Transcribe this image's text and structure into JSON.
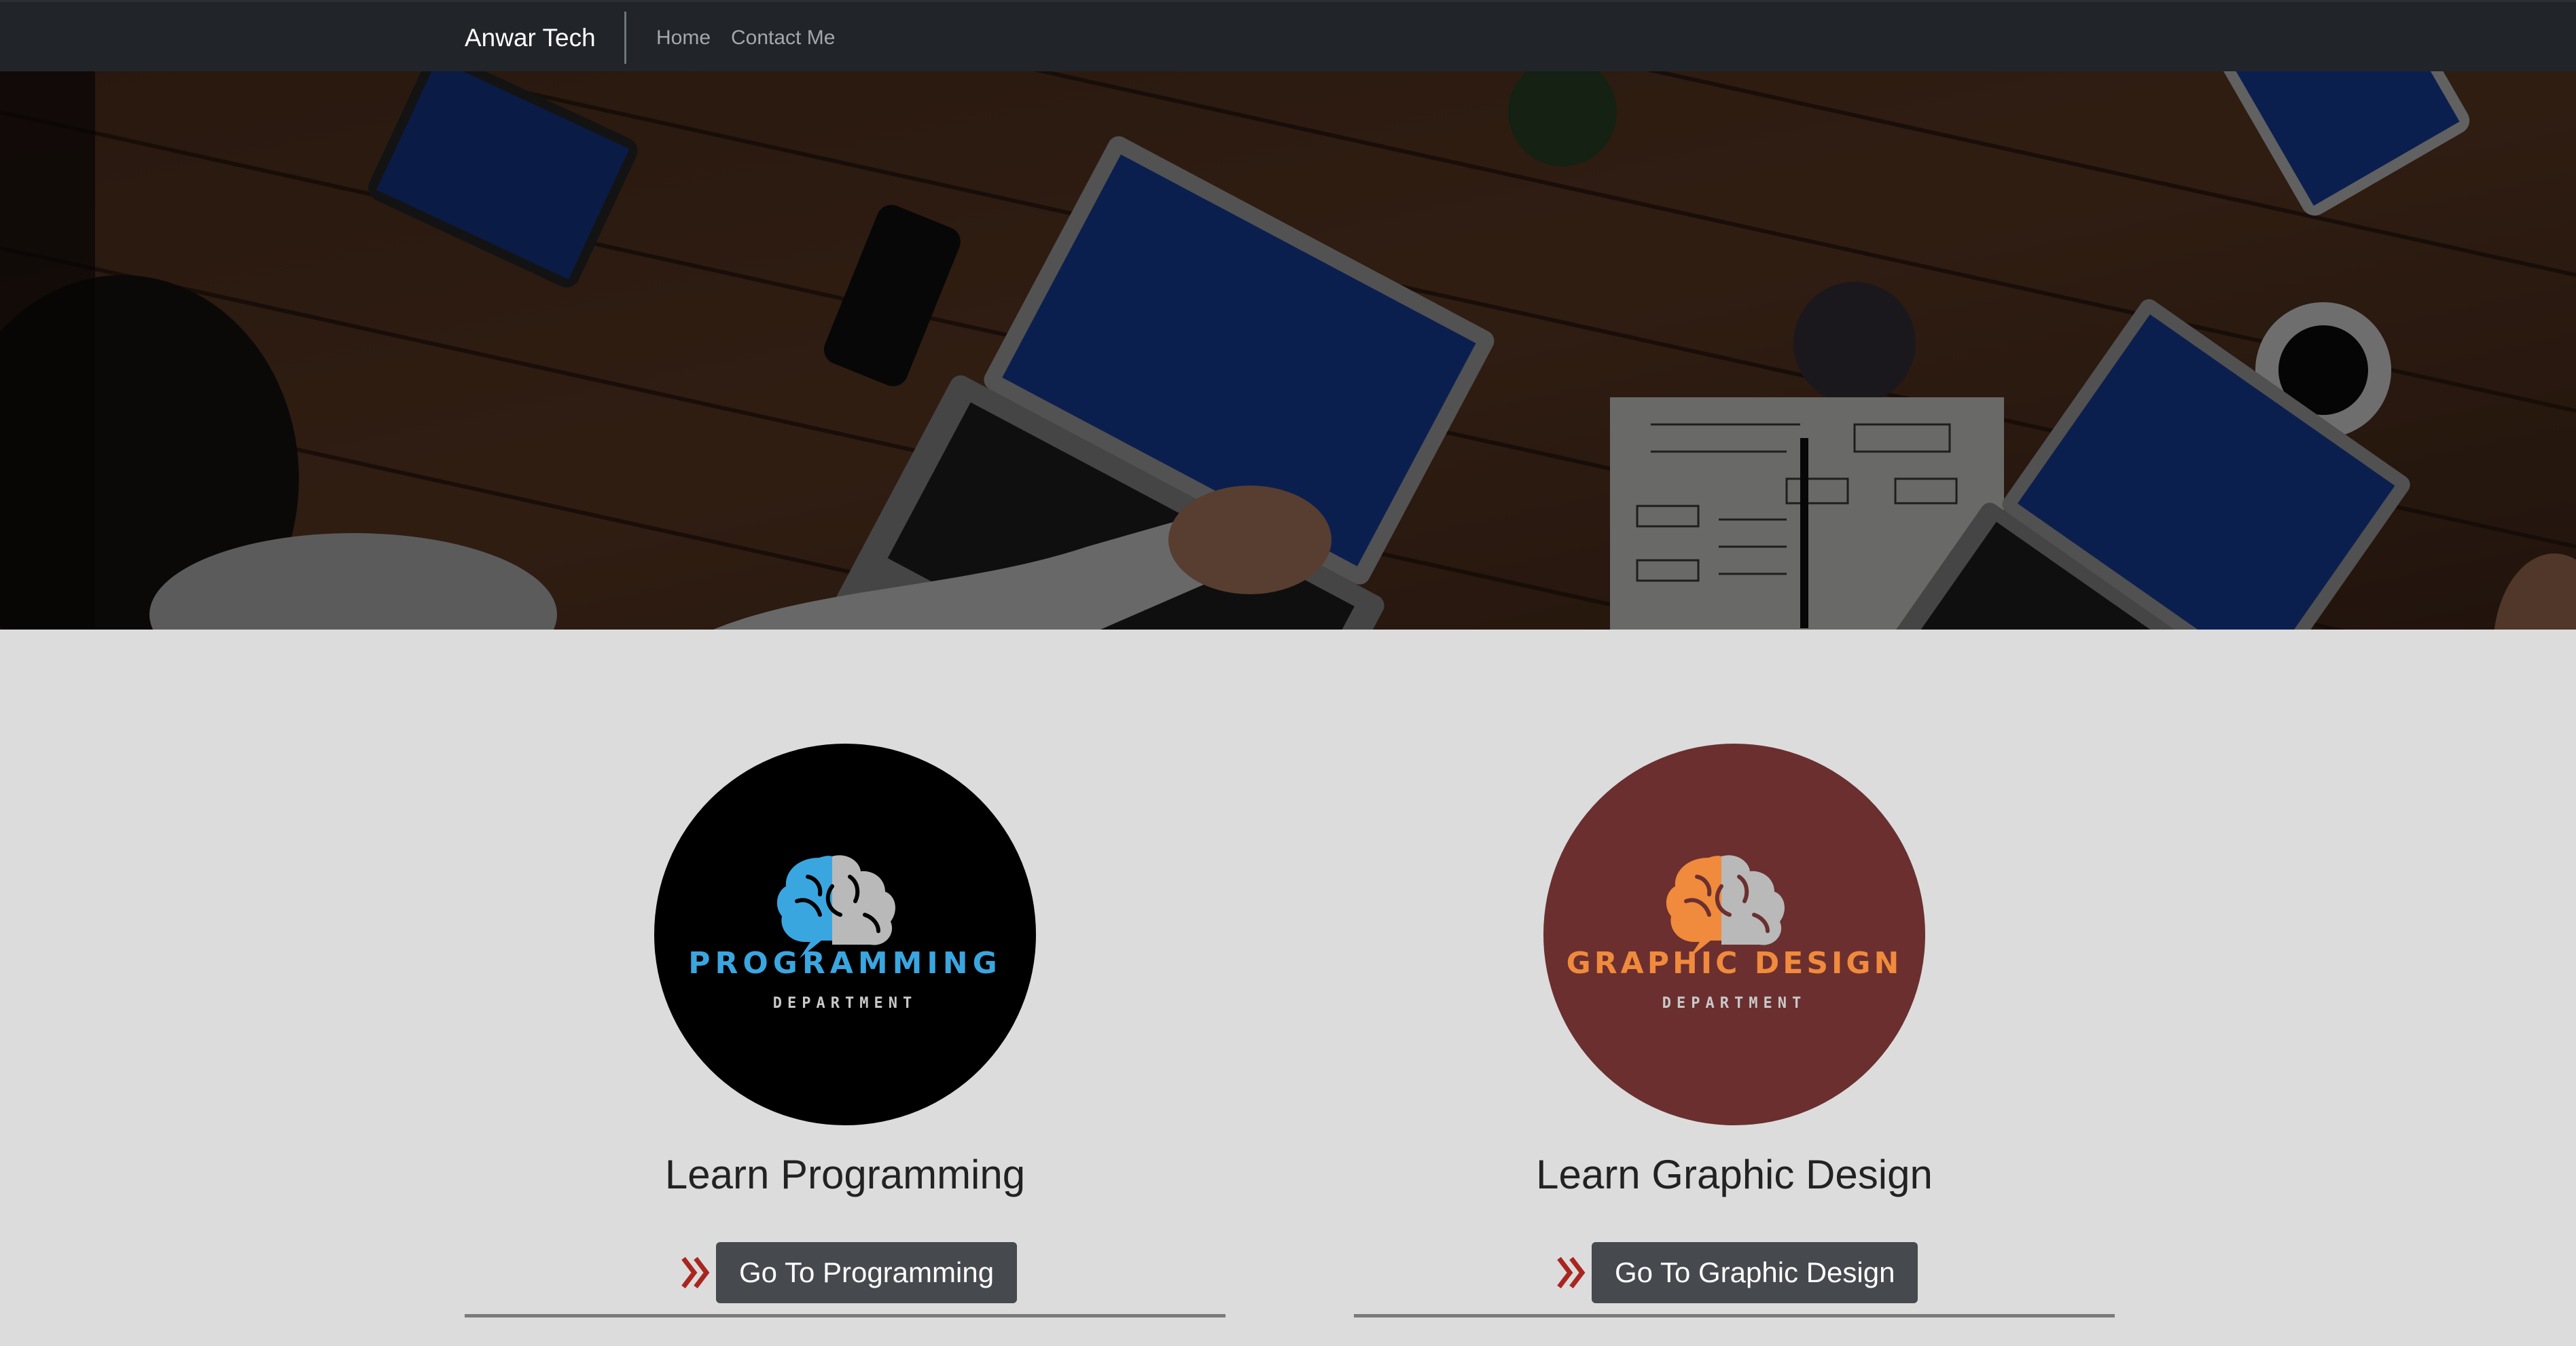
{
  "navbar": {
    "brand": "Anwar Tech",
    "links": [
      {
        "label": "Home"
      },
      {
        "label": "Contact Me"
      }
    ]
  },
  "hero": {
    "image": "workspace-desk-laptops-photo",
    "overlay_color": "#000000"
  },
  "cards": [
    {
      "logo": {
        "title": "PROGRAMMING",
        "subtitle": "DEPARTMENT",
        "background": "#000000",
        "accent": "#3aa6e0",
        "icon": "brain-icon"
      },
      "heading": "Learn Programming",
      "button_label": "Go To Programming",
      "chevron_icon": "double-chevron-right-icon"
    },
    {
      "logo": {
        "title": "GRAPHIC DESIGN",
        "subtitle": "DEPARTMENT",
        "background": "#6b2f2f",
        "accent": "#f08a3c",
        "icon": "brain-icon"
      },
      "heading": "Learn Graphic Design",
      "button_label": "Go To Graphic Design",
      "chevron_icon": "double-chevron-right-icon"
    }
  ],
  "colors": {
    "navbar_bg": "#212529",
    "page_bg": "#dcdcdc",
    "button_bg": "#464a4e",
    "chevron": "#a8261f"
  }
}
